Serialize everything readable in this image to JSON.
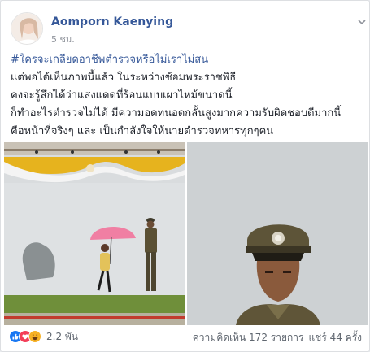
{
  "post": {
    "author": "Aomporn Kaenying",
    "timestamp": "5 ชม.",
    "text_lines": [
      "แต่พอได้เห็นภาพนี้แล้ว ในระหว่างซ้อมพระราชพิธี",
      "คงจะรู้สึกได้ว่าแสงแดดที่ร้อนแบบเผาไหม้ขนาดนี้",
      "ก็ทำอะไรตำรวจไม่ได้ มีความอดทนอดกลั้นสูงมากความรับผิดชอบดีมากนี้",
      "คือหน้าที่จริงๆ และ เป็นกำลังใจให้นายตำรวจทหารทุกๆคน"
    ],
    "hashtag": "#ใครจะเกลียดอาชีพตำรวจหรือไม่เราไม่สน"
  },
  "reactions": {
    "icons": [
      "like-icon",
      "love-icon",
      "haha-icon"
    ],
    "count": "2.2 พัน"
  },
  "stats": {
    "comments": "ความคิดเห็น 172 รายการ",
    "shares": "แชร์ 44 ครั้ง"
  },
  "colors": {
    "link": "#365899",
    "meta": "#90949c",
    "like": "#1877f2",
    "love": "#f33e58",
    "haha": "#f7b125"
  }
}
